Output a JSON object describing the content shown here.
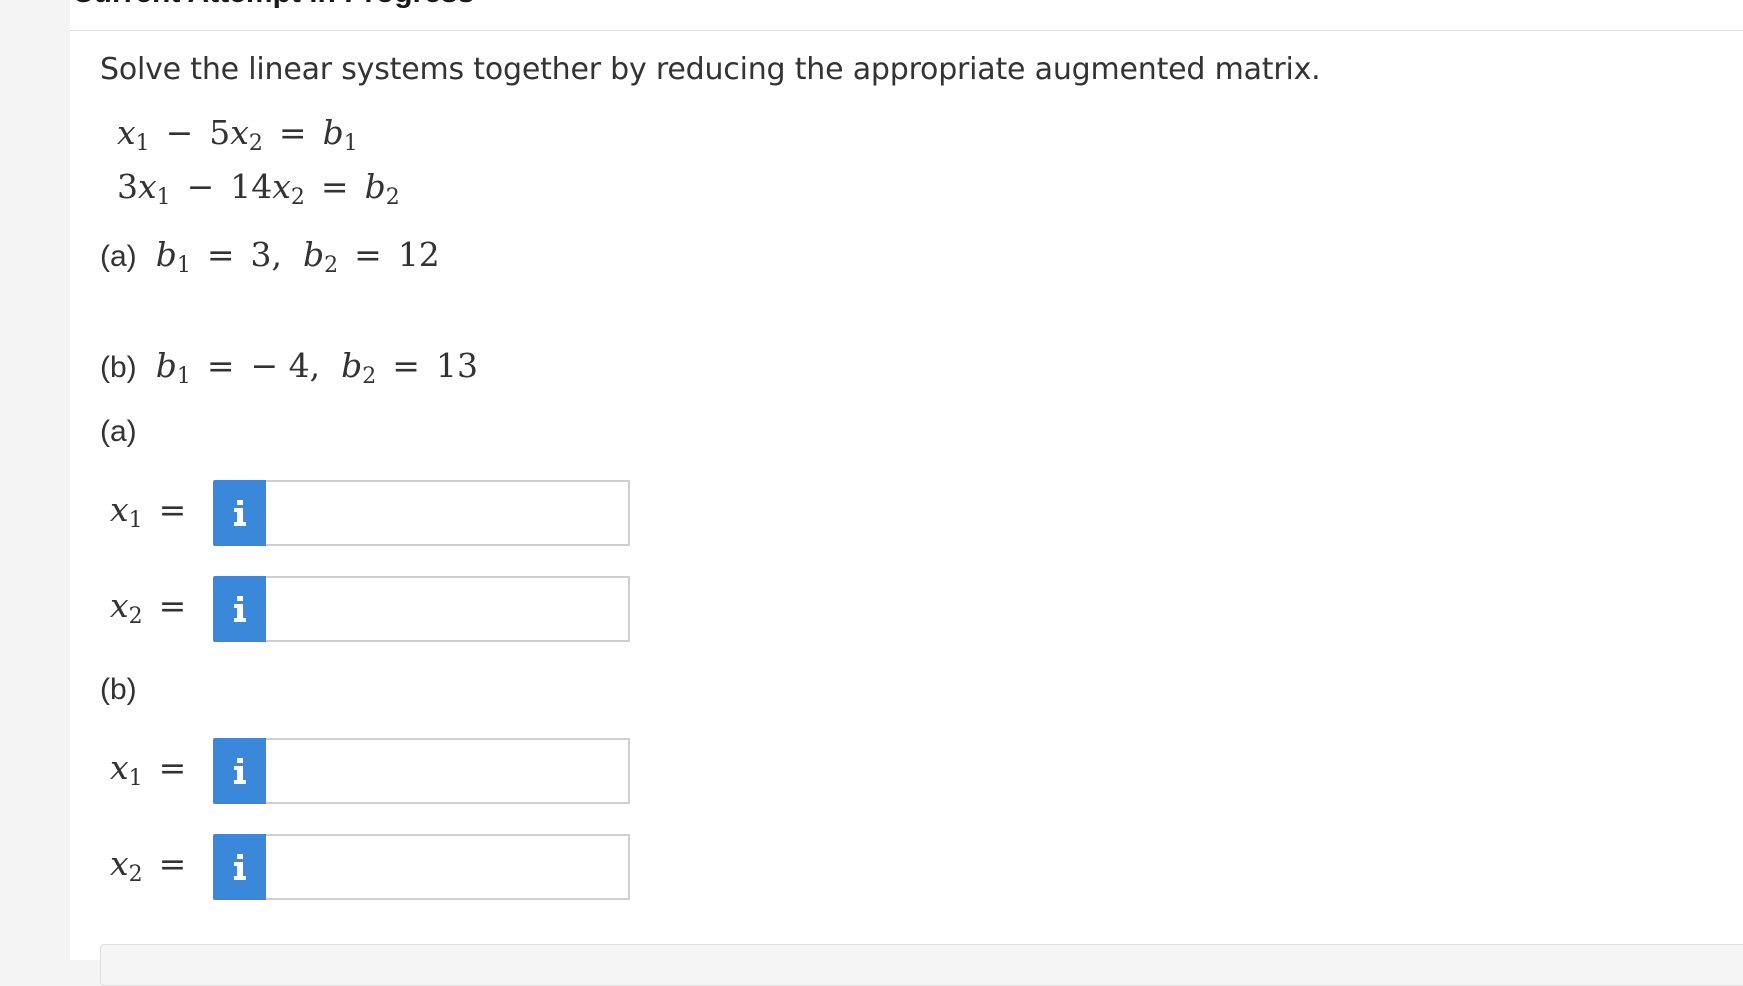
{
  "header": {
    "title": "Current Attempt in Progress"
  },
  "question": {
    "prompt": "Solve the linear systems together by reducing the appropriate augmented matrix.",
    "system": [
      {
        "c1": "",
        "v1": "x",
        "s1": "1",
        "op": "−",
        "c2": "5",
        "v2": "x",
        "s2": "2",
        "eq": "=",
        "rv": "b",
        "rs": "1"
      },
      {
        "c1": "3",
        "v1": "x",
        "s1": "1",
        "op": "−",
        "c2": "14",
        "v2": "x",
        "s2": "2",
        "eq": "=",
        "rv": "b",
        "rs": "2"
      }
    ],
    "part_a": {
      "label": "(a)",
      "b1_var": "b",
      "b1_sub": "1",
      "b1_value": "3,",
      "b2_var": "b",
      "b2_sub": "2",
      "b2_value": "12"
    },
    "part_b": {
      "label": "(b)",
      "b1_var": "b",
      "b1_sub": "1",
      "b1_value": "− 4,",
      "b2_var": "b",
      "b2_sub": "2",
      "b2_value": "13"
    }
  },
  "answers": {
    "a_label": "(a)",
    "b_label": "(b)",
    "rows": [
      {
        "var": "x",
        "sub": "1",
        "eq": "=",
        "info_icon": "info-icon",
        "value": ""
      },
      {
        "var": "x",
        "sub": "2",
        "eq": "=",
        "info_icon": "info-icon",
        "value": ""
      },
      {
        "var": "x",
        "sub": "1",
        "eq": "=",
        "info_icon": "info-icon",
        "value": ""
      },
      {
        "var": "x",
        "sub": "2",
        "eq": "=",
        "info_icon": "info-icon",
        "value": ""
      }
    ]
  },
  "colors": {
    "info_button": "#3b87d9",
    "text": "#333333",
    "input_border": "#cfcfcf"
  }
}
